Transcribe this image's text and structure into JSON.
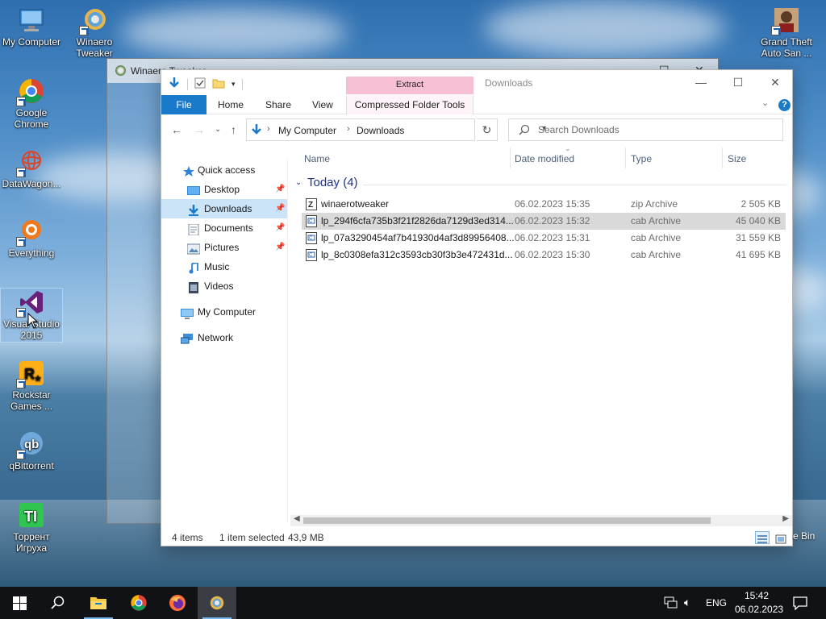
{
  "desktop": {
    "icons": [
      {
        "label": "My Computer",
        "icon": "computer-icon"
      },
      {
        "label": "Winaero Tweaker",
        "icon": "winaero-tweaker-icon"
      },
      {
        "label": "Google Chrome",
        "icon": "chrome-icon"
      },
      {
        "label": "DataWagon...",
        "icon": "datawagon-icon"
      },
      {
        "label": "Everything",
        "icon": "everything-icon"
      },
      {
        "label": "Visual Studio 2015",
        "icon": "visual-studio-icon"
      },
      {
        "label": "Rockstar Games ...",
        "icon": "rockstar-icon"
      },
      {
        "label": "qBittorrent",
        "icon": "qbittorrent-icon"
      },
      {
        "label": "Торрент Игруха",
        "icon": "torrent-igruha-icon"
      },
      {
        "label": "Grand Theft Auto San ...",
        "icon": "gta-icon"
      }
    ],
    "recycle_bin_peek": "e Bin"
  },
  "tweaker_window": {
    "title": "Winaero Tweaker"
  },
  "explorer": {
    "title": "Downloads",
    "extract_tab": "Extract",
    "ribbon_tabs": [
      "File",
      "Home",
      "Share",
      "View",
      "Compressed Folder Tools"
    ],
    "breadcrumb": [
      "My Computer",
      "Downloads"
    ],
    "search_placeholder": "Search Downloads",
    "nav": [
      {
        "label": "Quick access",
        "icon": "star-icon",
        "pinned": false
      },
      {
        "label": "Desktop",
        "icon": "desktop-folder-icon",
        "pinned": true
      },
      {
        "label": "Downloads",
        "icon": "downloads-folder-icon",
        "pinned": true,
        "active": true
      },
      {
        "label": "Documents",
        "icon": "documents-folder-icon",
        "pinned": true
      },
      {
        "label": "Pictures",
        "icon": "pictures-folder-icon",
        "pinned": true
      },
      {
        "label": "Music",
        "icon": "music-folder-icon",
        "pinned": false
      },
      {
        "label": "Videos",
        "icon": "videos-folder-icon",
        "pinned": false
      },
      {
        "label": "My Computer",
        "icon": "computer-icon",
        "pinned": false
      },
      {
        "label": "Network",
        "icon": "network-icon",
        "pinned": false
      }
    ],
    "columns": {
      "name": "Name",
      "date": "Date modified",
      "type": "Type",
      "size": "Size"
    },
    "group": "Today (4)",
    "files": [
      {
        "name": "winaerotweaker",
        "date": "06.02.2023 15:35",
        "type": "zip Archive",
        "size": "2 505 KB",
        "icon": "zip-archive-icon",
        "selected": false
      },
      {
        "name": "lp_294f6cfa735b3f21f2826da7129d3ed314...",
        "date": "06.02.2023 15:32",
        "type": "cab Archive",
        "size": "45 040 KB",
        "icon": "cab-archive-icon",
        "selected": true
      },
      {
        "name": "lp_07a3290454af7b41930d4af3d89956408...",
        "date": "06.02.2023 15:31",
        "type": "cab Archive",
        "size": "31 559 KB",
        "icon": "cab-archive-icon",
        "selected": false
      },
      {
        "name": "lp_8c0308efa312c3593cb30f3b3e472431d...",
        "date": "06.02.2023 15:30",
        "type": "cab Archive",
        "size": "41 695 KB",
        "icon": "cab-archive-icon",
        "selected": false
      }
    ],
    "status": {
      "items": "4 items",
      "selection": "1 item selected",
      "size": "43,9 MB"
    }
  },
  "taskbar": {
    "apps": [
      "start-icon",
      "search-icon",
      "file-explorer-icon",
      "chrome-icon",
      "firefox-icon",
      "winaero-tweaker-icon"
    ],
    "language": "ENG",
    "time": "15:42",
    "date": "06.02.2023"
  },
  "colors": {
    "accent": "#1979ca",
    "selection": "#cce4f7",
    "extract_tab": "#f7bfd6",
    "taskbar": "#101216"
  }
}
